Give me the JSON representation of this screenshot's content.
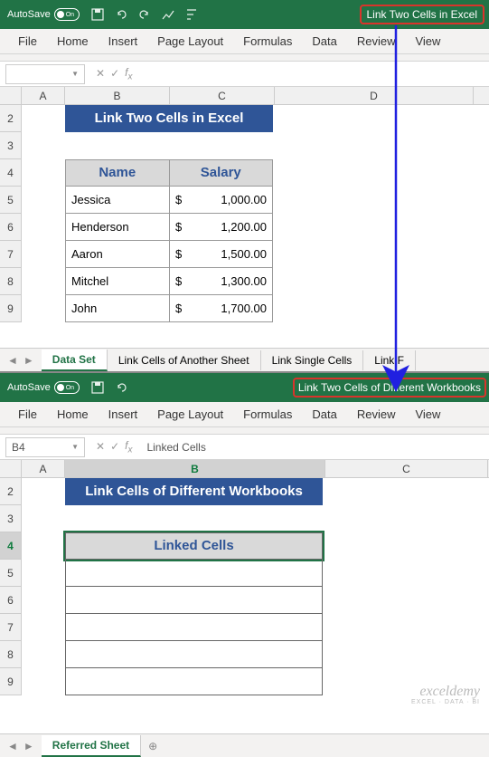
{
  "win1": {
    "autosave_label": "AutoSave",
    "autosave_state": "On",
    "workbook_name": "Link Two Cells in Excel",
    "ribbon": [
      "File",
      "Home",
      "Insert",
      "Page Layout",
      "Formulas",
      "Data",
      "Review",
      "View"
    ],
    "namebox": "",
    "formula": "",
    "cols": {
      "A": 24,
      "B": 116,
      "C": 116,
      "D": 200
    },
    "rows": [
      "2",
      "3",
      "4",
      "5",
      "6",
      "7",
      "8",
      "9"
    ],
    "banner": "Link Two Cells in Excel",
    "headers": {
      "name": "Name",
      "salary": "Salary"
    },
    "data": [
      {
        "name": "Jessica",
        "salary": "1,000.00"
      },
      {
        "name": "Henderson",
        "salary": "1,200.00"
      },
      {
        "name": "Aaron",
        "salary": "1,500.00"
      },
      {
        "name": "Mitchel",
        "salary": "1,300.00"
      },
      {
        "name": "John",
        "salary": "1,700.00"
      }
    ],
    "currency": "$",
    "sheets": [
      "Data Set",
      "Link Cells of Another Sheet",
      "Link Single Cells",
      "Link F"
    ],
    "active_sheet": 0
  },
  "win2": {
    "autosave_label": "AutoSave",
    "autosave_state": "On",
    "workbook_name": "Link Two Cells of Different Workbooks",
    "ribbon": [
      "File",
      "Home",
      "Insert",
      "Page Layout",
      "Formulas",
      "Data",
      "Review",
      "View"
    ],
    "namebox": "B4",
    "formula": "Linked Cells",
    "cols": {
      "A": 24,
      "B": 288,
      "C": 180
    },
    "rows": [
      "2",
      "3",
      "4",
      "5",
      "6",
      "7",
      "8",
      "9"
    ],
    "banner": "Link Cells of Different Workbooks",
    "linked_header": "Linked Cells",
    "sheets": [
      "Referred Sheet"
    ],
    "active_sheet": 0
  },
  "watermark": {
    "line1": "exceldemy",
    "line2": "EXCEL · DATA · BI"
  }
}
